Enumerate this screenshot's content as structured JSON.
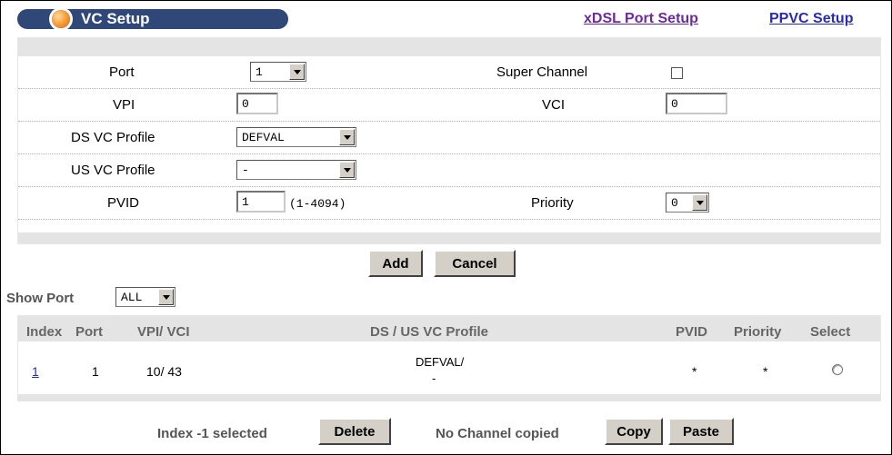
{
  "header": {
    "title": "VC Setup",
    "link_xdsl": "xDSL Port Setup",
    "link_ppvc": "PPVC Setup"
  },
  "form": {
    "port_label": "Port",
    "port_value": "1",
    "super_channel_label": "Super Channel",
    "super_channel_checked": false,
    "vpi_label": "VPI",
    "vpi_value": "0",
    "vci_label": "VCI",
    "vci_value": "0",
    "ds_profile_label": "DS VC Profile",
    "ds_profile_value": "DEFVAL",
    "us_profile_label": "US VC Profile",
    "us_profile_value": "-",
    "pvid_label": "PVID",
    "pvid_value": "1",
    "pvid_hint": "(1-4094)",
    "priority_label": "Priority",
    "priority_value": "0"
  },
  "actions": {
    "add": "Add",
    "cancel": "Cancel"
  },
  "filter": {
    "show_port_label": "Show Port",
    "show_port_value": "ALL"
  },
  "table": {
    "headers": [
      "Index",
      "Port",
      "VPI/ VCI",
      "DS / US VC Profile",
      "PVID",
      "Priority",
      "Select"
    ],
    "rows": [
      {
        "index": "1",
        "port": "1",
        "vpi_vci": "10/ 43",
        "ds_profile": "DEFVAL/",
        "us_profile": "-",
        "pvid": "*",
        "priority": "*"
      }
    ]
  },
  "footer": {
    "index_selected": "Index -1 selected",
    "delete": "Delete",
    "no_channel": "No Channel copied",
    "copy": "Copy",
    "paste": "Paste"
  },
  "colors": {
    "title_bar": "#304878",
    "band": "#e4e4e4",
    "link_visited": "#6b2aa0",
    "link": "#2a2ab8"
  }
}
